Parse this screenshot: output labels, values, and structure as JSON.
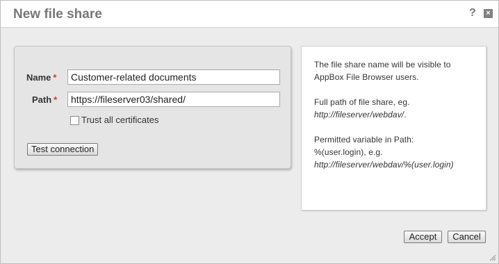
{
  "dialog": {
    "title": "New file share",
    "help_icon": "?",
    "close_icon": "×"
  },
  "form": {
    "name_label": "Name",
    "path_label": "Path",
    "required_mark": "*",
    "name_value": "Customer-related documents",
    "path_value": "https://fileserver03/shared/",
    "trust_label": "Trust all certificates",
    "trust_checked": false,
    "test_button": "Test connection"
  },
  "help": {
    "line1": "The file share name will be visible to",
    "line2": "AppBox File Browser users.",
    "line3": "Full path of file share, eg.",
    "line4": "http://fileserver/webdav/",
    "line4_suffix": ".",
    "line5": "Permitted variable in Path:",
    "line6": "%(user.login), e.g.",
    "line7": "http://fileserver/webdav/%(user.login)"
  },
  "footer": {
    "accept": "Accept",
    "cancel": "Cancel"
  },
  "colors": {
    "background": "#ececec",
    "panel": "#e5e5e5",
    "required": "#dd3333",
    "title": "#777777"
  }
}
